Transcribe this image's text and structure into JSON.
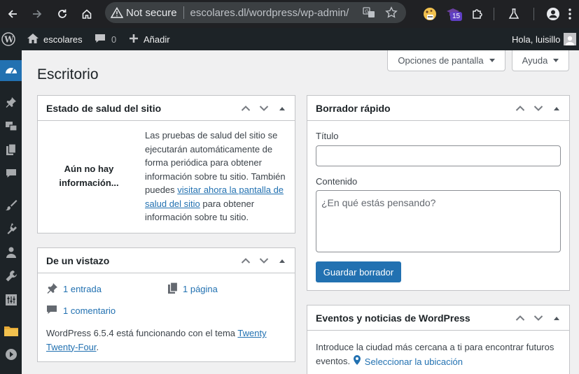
{
  "browser": {
    "security_label": "Not secure",
    "url": "escolares.dl/wordpress/wp-admin/",
    "extension_badge": "15"
  },
  "adminbar": {
    "site_name": "escolares",
    "comments_count": "0",
    "new_label": "Añadir",
    "greeting": "Hola, luisillo"
  },
  "screen": {
    "options_label": "Opciones de pantalla",
    "help_label": "Ayuda",
    "page_title": "Escritorio"
  },
  "site_health": {
    "title": "Estado de salud del sitio",
    "no_info": "Aún no hay información...",
    "text_before": "Las pruebas de salud del sitio se ejecutarán automáticamente de forma periódica para obtener información sobre tu sitio. También puedes ",
    "link": "visitar ahora la pantalla de salud del sitio",
    "text_after": " para obtener información sobre tu sitio."
  },
  "glance": {
    "title": "De un vistazo",
    "posts": "1 entrada",
    "pages": "1 página",
    "comments": "1 comentario",
    "version_text": "WordPress 6.5.4 está funcionando con el tema ",
    "theme_link": "Twenty Twenty-Four",
    "period": "."
  },
  "quick_draft": {
    "title": "Borrador rápido",
    "title_label": "Título",
    "title_value": "",
    "content_label": "Contenido",
    "content_placeholder": "¿En qué estás pensando?",
    "save_label": "Guardar borrador"
  },
  "events": {
    "title": "Eventos y noticias de WordPress",
    "intro": "Introduce la ciudad más cercana a ti para encontrar futuros eventos.",
    "location_link": "Seleccionar la ubicación"
  }
}
